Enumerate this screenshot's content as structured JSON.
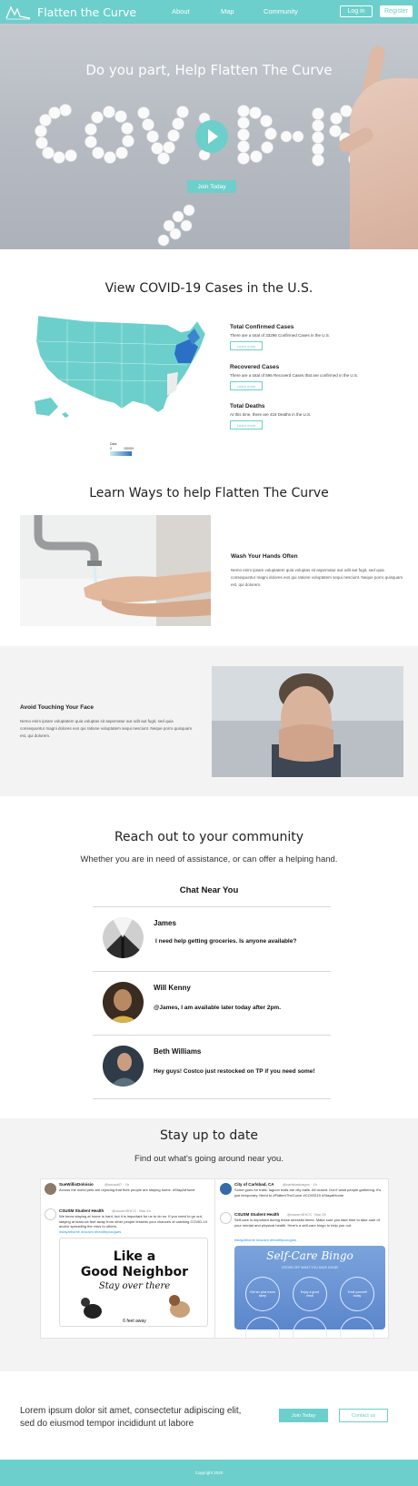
{
  "nav": {
    "brand": "Flatten the Curve",
    "links": [
      "About",
      "Map",
      "Community"
    ],
    "login": "Log in",
    "register": "Register"
  },
  "hero": {
    "title": "Do you part, Help Flatten The Curve",
    "button": "Join Today"
  },
  "cases": {
    "title": "View COVID-19 Cases in the U.S.",
    "stats": [
      {
        "heading": "Total Confirmed Cases",
        "text": "There are a total of 33296 Confirmed Cases in the U.S.",
        "button": "Learn more"
      },
      {
        "heading": "Recovered Cases",
        "text": "There are a total of 596 Recoverd Cases that are confirmed in the U.S.",
        "button": "Learn more"
      },
      {
        "heading": "Total Deaths",
        "text": "At this time, there are 418 Deaths in the U.S.",
        "button": "Learn more"
      }
    ],
    "legend": {
      "label": "Data",
      "min": "0",
      "max": "15000+"
    }
  },
  "ways": {
    "title": "Learn Ways to help Flatten The Curve",
    "items": [
      {
        "heading": "Wash Your Hands Often",
        "text": "Nemo enim ipsam voluptatem quia voluptas sit aspernatur aut odit aut fugit, sed quia consequuntur magni dolores eos qui ratione voluptatem sequi nesciunt. Neque porro quisquam est, qui dolorem."
      },
      {
        "heading": "Avoid Touching Your Face",
        "text": "Nemo enim ipsam voluptatem quia voluptas sit aspernatur aut odit aut fugit, sed quia consequuntur magni dolores eos qui ratione voluptatem sequi nesciunt. Neque porro quisquam est, qui dolorem."
      }
    ]
  },
  "community": {
    "title": "Reach out to your community",
    "subtitle": "Whether you are in need of assistance, or can offer a helping hand.",
    "chat_title": "Chat Near You",
    "chats": [
      {
        "name": "James",
        "message": "I need help getting groceries. Is anyone available?"
      },
      {
        "name": "Will Kenny",
        "message": "@James, I am available later today after 2pm."
      },
      {
        "name": "Beth Williams",
        "message": "Hey guys! Costco just restocked on TP if you need some!"
      }
    ]
  },
  "updates": {
    "title": "Stay up to date",
    "subtitle": "Find out what's going around near you.",
    "tweets_left": {
      "t1_name": "SueWillisDoloisio",
      "t1_handle": "@sousa07 · 1h",
      "t1_text": "Across the world pets are rejoicing that their people are staying home. #StayAtHome",
      "t2_name": "CSUSM Student Health",
      "t2_handle": "@csusmSHCS · Mar 24",
      "t2_text": "We know staying at home is hard, but it is important for us to do so. If you need to go out, staying at least six feet away from other people lessens your chances of catching COVID-19 and/or spreading the virus to others.",
      "t2_tags": "#stayathome #csusm #healthycougars",
      "poster_line1": "Like a",
      "poster_line2": "Good Neighbor",
      "poster_line3": "Stay over there",
      "poster_bottom": "6 feet away"
    },
    "tweets_right": {
      "t1_name": "City of Carlsbad, CA",
      "t1_handle": "@carlsbadcagov · 1h",
      "t1_text": "Some goes for trails: lagoon trails are city trails. All closed. Don't want people gathering. It's just temporary. Need to #FlattenTheCurve #COVID19 #StayatHome",
      "t2_name": "CSUSM Student Health",
      "t2_handle": "@csusmSHCS · Mar 25",
      "t2_text": "Self-care is important during these stressful times. Make sure you take time to take care of your mental and physical health. Here's a self-care bingo to help you out.",
      "t2_tags": "#stayathome #csusm #healthycougars",
      "bingo_title": "Self-Care Bingo",
      "bingo_sub": "CROSS OFF WHAT YOU HAVE DONE!",
      "bingo_cells": [
        "Get six plus hours sleep",
        "Enjoy a good meal",
        "Treat yourself today"
      ]
    }
  },
  "cta": {
    "text": "Lorem ipsum dolor sit amet, consectetur adipiscing elit, sed do eiusmod tempor incididunt ut labore",
    "join": "Join Today",
    "contact": "Contact us"
  },
  "footer": {
    "text": "Copyright 2020"
  },
  "colors": {
    "accent": "#6ccfcb",
    "map_base": "#6ccfcb",
    "map_hot": "#2b6fc7"
  }
}
